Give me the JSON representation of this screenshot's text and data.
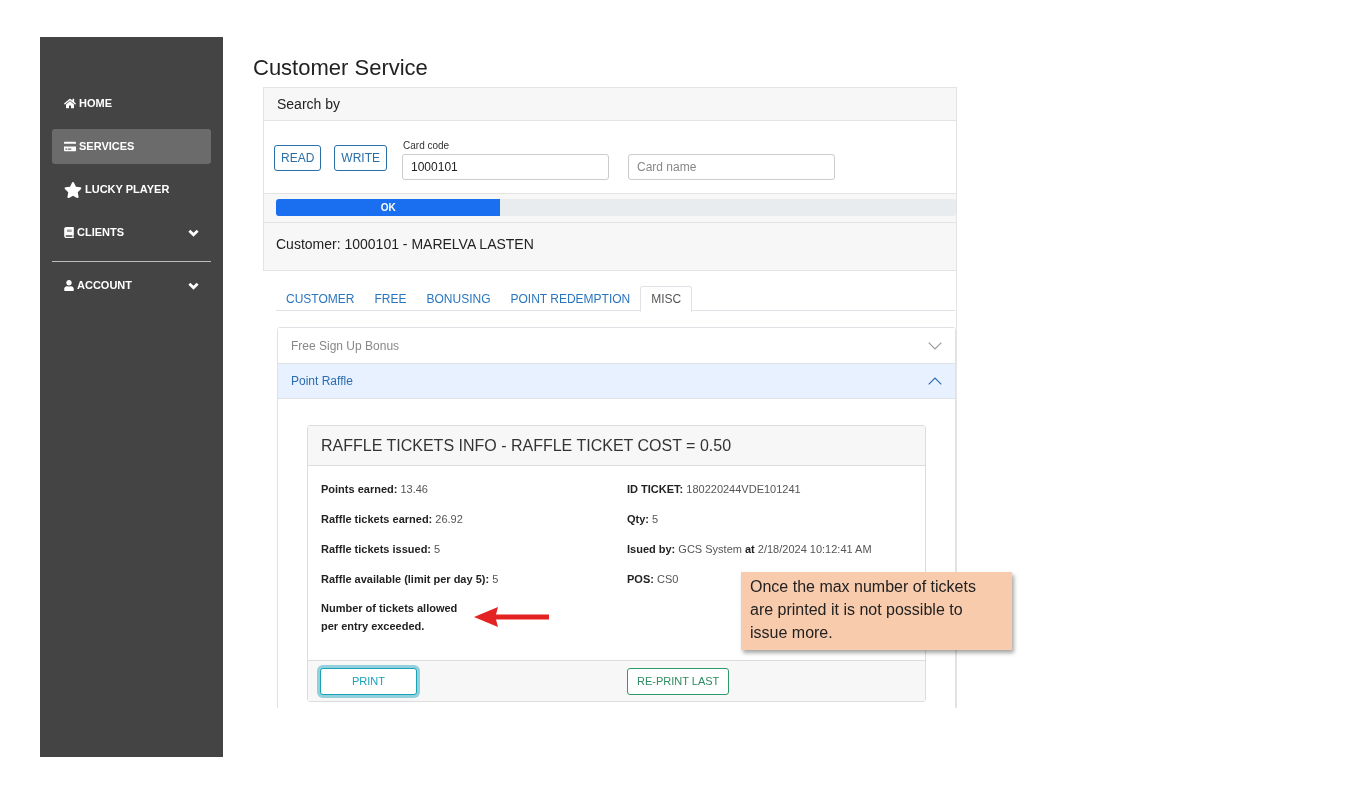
{
  "sidebar": {
    "groups": [
      {
        "items": [
          {
            "label": "HOME",
            "selected": false
          },
          {
            "label": "SERVICES",
            "selected": true
          },
          {
            "label": "LUCKY PLAYER",
            "selected": false
          },
          {
            "label": "CLIENTS",
            "selected": false,
            "expanded": false
          }
        ]
      },
      {
        "items": [
          {
            "label": "ACCOUNT",
            "selected": false,
            "expanded": false
          }
        ]
      }
    ]
  },
  "page_title": "Customer Service",
  "search": {
    "title": "Search by",
    "buttons": [
      "READ",
      "WRITE"
    ],
    "card_code": {
      "label": "Card code",
      "value": "1000101"
    },
    "card_name": {
      "placeholder": "Card name"
    },
    "progress": {
      "level": 0.33,
      "label": "OK"
    }
  },
  "customer": "Customer: 1000101 - MARELVA LASTEN",
  "tabs": [
    {
      "label": "CUSTOMER",
      "selected": false
    },
    {
      "label": "FREE",
      "selected": false
    },
    {
      "label": "BONUSING",
      "selected": false
    },
    {
      "label": "POINT REDEMPTION",
      "selected": false
    },
    {
      "label": "MISC",
      "selected": true
    }
  ],
  "accordion": [
    {
      "title": "Free Sign Up Bonus",
      "expanded": false
    },
    {
      "title": "Point Raffle",
      "expanded": true,
      "raffle": {
        "title": "RAFFLE TICKETS INFO - RAFFLE TICKET COST = 0.50",
        "left": [
          "**Points earned:** 13.46",
          "**Raffle tickets earned:** 26.92",
          "**Raffle tickets issued:** 5",
          "**Raffle available (limit per day 5):** 5"
        ],
        "message": "Number of tickets allowed per entry exceeded.",
        "right": [
          "**ID TICKET:** 180220244VDE101241",
          "**Qty:** 5",
          "**Isued by:** GCS System **at** 2/18/2024 10:12:41 AM",
          "**POS:** CS0"
        ],
        "buttons": [
          {
            "label": "PRINT",
            "kind": "info",
            "focused": true
          },
          {
            "label": "RE-PRINT LAST",
            "kind": "success",
            "focused": false
          }
        ]
      }
    }
  ],
  "annotation": {
    "text": "Once the max number of tickets are printed it is not possible to issue more."
  }
}
